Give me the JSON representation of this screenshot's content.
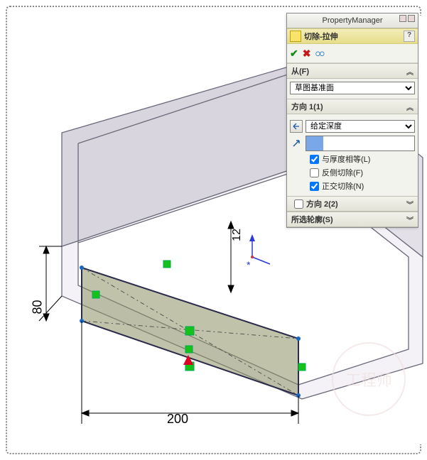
{
  "panel": {
    "title": "PropertyManager",
    "feature_name": "切除-拉伸",
    "from": {
      "label": "从(F)",
      "selected": "草图基准面"
    },
    "direction1": {
      "label": "方向 1(1)",
      "end_condition": "给定深度",
      "depth_value": "",
      "link_to_thickness": {
        "label": "与厚度相等(L)",
        "checked": true
      },
      "flip_side": {
        "label": "反侧切除(F)",
        "checked": false
      },
      "normal_cut": {
        "label": "正交切除(N)",
        "checked": true
      }
    },
    "direction2": {
      "label": "方向 2(2)"
    },
    "contours": {
      "label": "所选轮廓(S)"
    }
  },
  "dimensions": {
    "width": "200",
    "height": "80",
    "offset": "12"
  },
  "watermark": "工程师"
}
